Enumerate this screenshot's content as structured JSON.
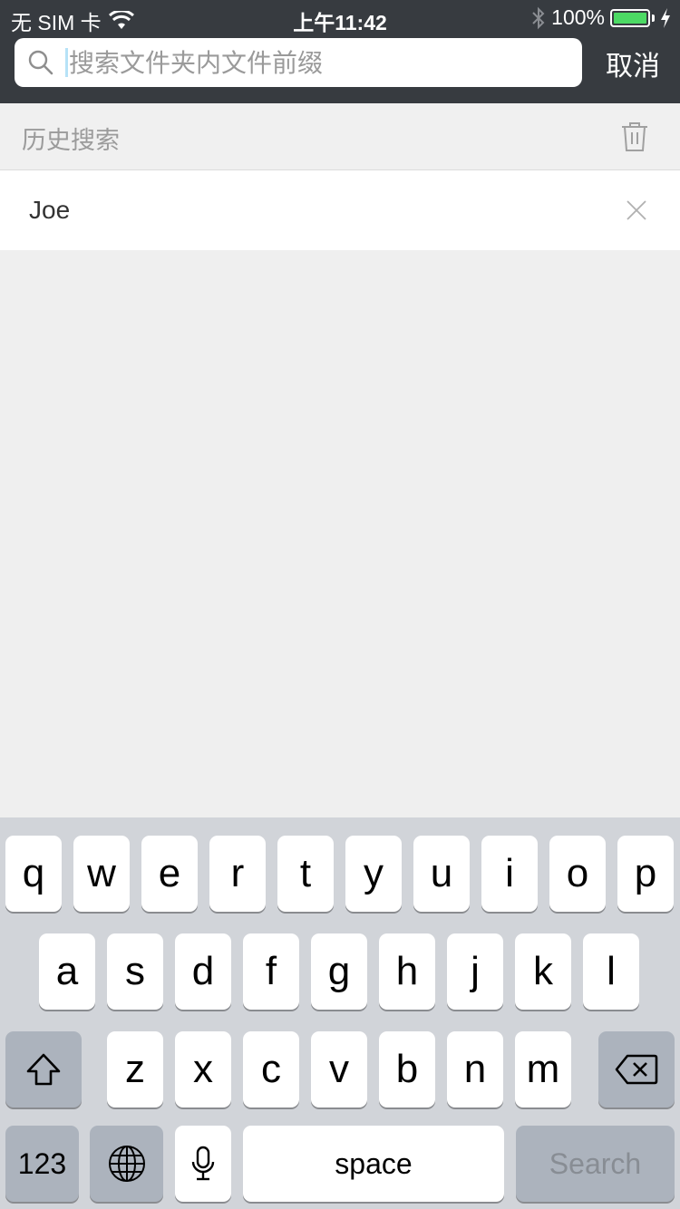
{
  "status_bar": {
    "carrier": "无 SIM 卡",
    "time": "上午11:42",
    "battery": "100%",
    "battery_level": 1.0,
    "icons": [
      "wifi-icon",
      "bluetooth-icon",
      "battery-icon",
      "charging-bolt-icon"
    ]
  },
  "search": {
    "placeholder": "搜索文件夹内文件前缀",
    "value": "",
    "cancel_label": "取消"
  },
  "history": {
    "title": "历史搜索",
    "items": [
      {
        "label": "Joe"
      }
    ]
  },
  "keyboard": {
    "row1": [
      "q",
      "w",
      "e",
      "r",
      "t",
      "y",
      "u",
      "i",
      "o",
      "p"
    ],
    "row2": [
      "a",
      "s",
      "d",
      "f",
      "g",
      "h",
      "j",
      "k",
      "l"
    ],
    "row3": [
      "z",
      "x",
      "c",
      "v",
      "b",
      "n",
      "m"
    ],
    "numbers_label": "123",
    "space_label": "space",
    "action_label": "Search"
  },
  "colors": {
    "topbar": "#373b40",
    "battery": "#4cd964",
    "keyboard_bg": "#d1d4d9"
  }
}
